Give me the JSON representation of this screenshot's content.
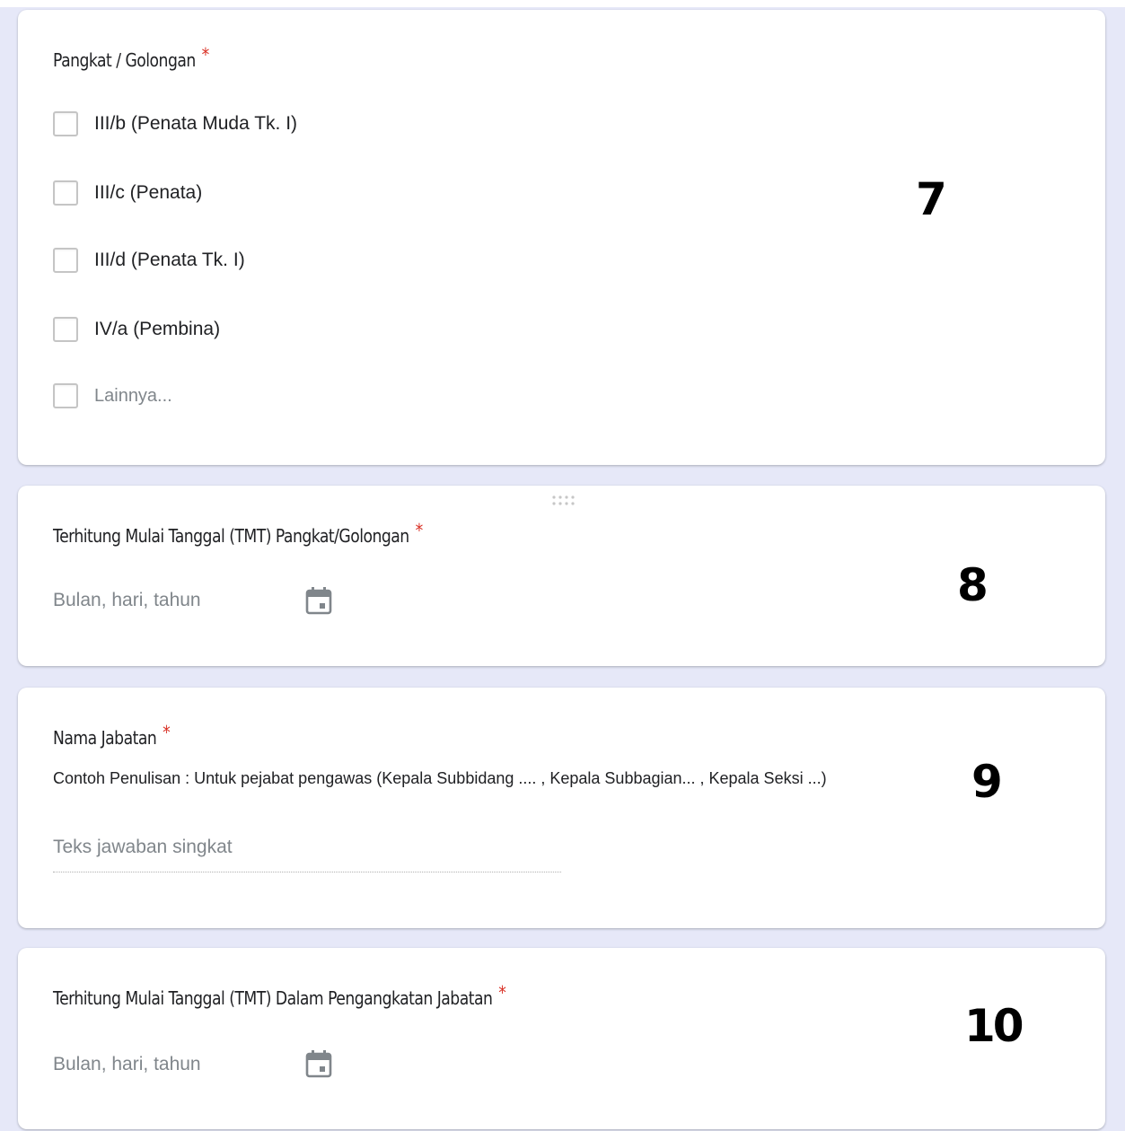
{
  "questions": {
    "q7": {
      "title": "Pangkat / Golongan",
      "required_mark": "*",
      "options": [
        {
          "label": "III/b (Penata Muda Tk. I)"
        },
        {
          "label": "III/c (Penata)"
        },
        {
          "label": "III/d (Penata Tk. I)"
        },
        {
          "label": "IV/a (Pembina)"
        }
      ],
      "other_label": "Lainnya...",
      "annotation": "7"
    },
    "q8": {
      "title": "Terhitung Mulai Tanggal (TMT) Pangkat/Golongan",
      "required_mark": "*",
      "date_placeholder": "Bulan, hari, tahun",
      "annotation": "8"
    },
    "q9": {
      "title": "Nama Jabatan",
      "required_mark": "*",
      "description": "Contoh Penulisan : Untuk pejabat pengawas (Kepala Subbidang .... , Kepala Subbagian... , Kepala Seksi ...)",
      "answer_placeholder": "Teks jawaban singkat",
      "annotation": "9"
    },
    "q10": {
      "title": "Terhitung Mulai Tanggal (TMT) Dalam Pengangkatan Jabatan",
      "required_mark": "*",
      "date_placeholder": "Bulan, hari, tahun",
      "annotation": "10"
    }
  },
  "colors": {
    "background": "#e6e8f8",
    "card": "#ffffff",
    "required": "#d93025",
    "placeholder": "#80868b",
    "text": "#202124"
  },
  "icons": {
    "calendar": "calendar-icon",
    "drag": "drag-handle-icon",
    "checkbox": "checkbox-icon"
  }
}
